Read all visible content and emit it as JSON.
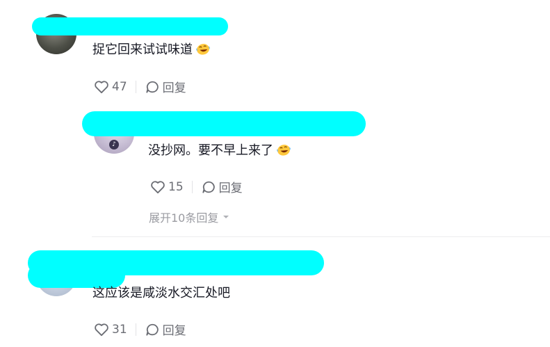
{
  "comments": [
    {
      "text": "捉它回来试试味道",
      "emoji_icon": "laughing-crying-emoji",
      "likes": "47",
      "reply_label": "回复"
    },
    {
      "text": "没抄网。要不早上来了",
      "emoji_icon": "laughing-crying-emoji",
      "likes": "15",
      "reply_label": "回复",
      "expand_label": "展开10条回复"
    },
    {
      "text": "这应该是咸淡水交汇处吧",
      "likes": "31",
      "reply_label": "回复"
    }
  ],
  "colors": {
    "redaction": "#00ffff",
    "text": "#161823",
    "meta": "#6b6d74",
    "muted": "#9a9ba1"
  }
}
